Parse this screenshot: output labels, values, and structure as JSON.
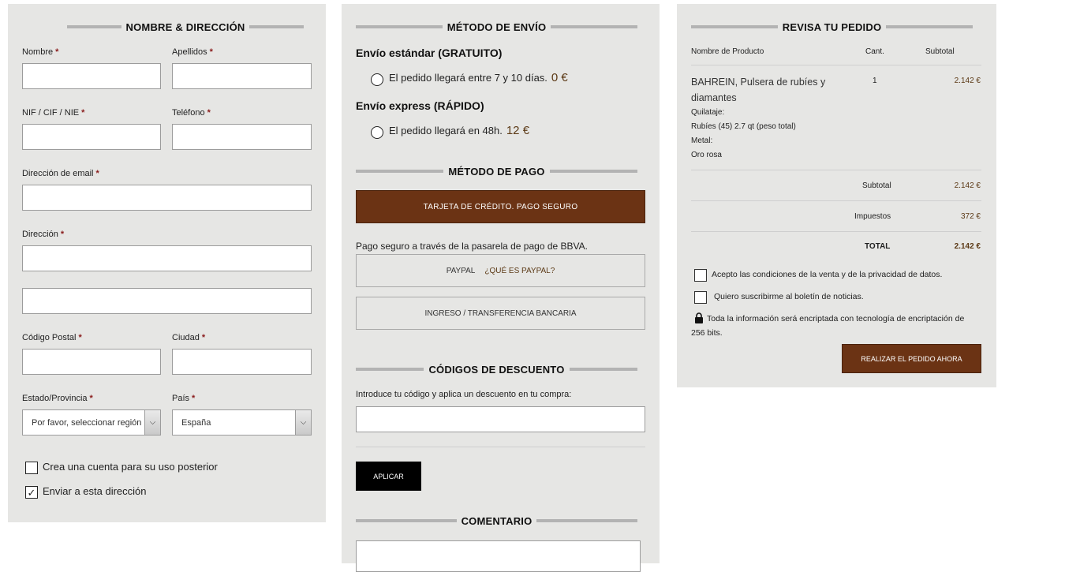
{
  "billing": {
    "title": "NOMBRE & DIRECCIÓN",
    "labels": {
      "nombre": "Nombre",
      "apellidos": "Apellidos",
      "nif": "NIF / CIF / NIE",
      "telefono": "Teléfono",
      "email": "Dirección de email",
      "direccion": "Dirección",
      "cp": "Código Postal",
      "ciudad": "Ciudad",
      "estado": "Estado/Provincia",
      "pais": "País"
    },
    "required_mark": "*",
    "estado_value": "Por favor, seleccionar región",
    "pais_value": "España",
    "create_account": "Crea una cuenta para su uso posterior",
    "send_to_address": "Enviar a esta dirección",
    "create_account_checked": false,
    "send_to_address_checked": true,
    "check_mark": "✓"
  },
  "shipping": {
    "title": "MÉTODO DE ENVÍO",
    "options": [
      {
        "title": "Envío estándar (GRATUITO)",
        "text": "El pedido llegará entre 7 y 10 días.",
        "price": "0 €"
      },
      {
        "title": "Envío express (RÁPIDO)",
        "text": "El pedido llegará en 48h.",
        "price": "12 €"
      }
    ]
  },
  "payment": {
    "title": "MÉTODO DE PAGO",
    "card": "TARJETA DE CRÉDITO. PAGO SEGURO",
    "card_note": "Pago seguro a través de la pasarela de pago de BBVA.",
    "paypal": "PAYPAL",
    "paypal_link": "¿QUÉ ES PAYPAL?",
    "transfer": "INGRESO / TRANSFERENCIA BANCARIA"
  },
  "discount": {
    "title": "CÓDIGOS DE DESCUENTO",
    "note": "Introduce tu código y aplica un descuento en tu compra:",
    "apply": "APLICAR"
  },
  "comment": {
    "title": "COMENTARIO"
  },
  "review": {
    "title": "REVISA TU PEDIDO",
    "headers": {
      "product": "Nombre de Producto",
      "qty": "Cant.",
      "subtotal": "Subtotal"
    },
    "item": {
      "name_line1": "BAHREIN, Pulsera de rubíes y",
      "name_line2": "diamantes",
      "qty": "1",
      "price": "2.142 €",
      "attr1_label": "Quilataje:",
      "attr1_value": "Rubíes (45) 2.7 qt (peso total)",
      "attr2_label": "Metal:",
      "attr2_value": "Oro rosa"
    },
    "subtotal_label": "Subtotal",
    "subtotal_value": "2.142 €",
    "tax_label": "Impuestos",
    "tax_value": "372 €",
    "total_label": "TOTAL",
    "total_value": "2.142 €",
    "accept_terms": "Acepto las condiciones de la venta y de la privacidad de datos.",
    "newsletter": "Quiero suscribirme al boletín de noticias.",
    "security_line1": "Toda la información será encriptada con tecnología de encriptación de",
    "security_line2": "256 bits.",
    "place_order": "REALIZAR EL PEDIDO AHORA"
  },
  "colors": {
    "panel": "#e6e6e4",
    "accent": "#6b3314",
    "price": "#5c3a16",
    "required": "#8a1c1c"
  }
}
